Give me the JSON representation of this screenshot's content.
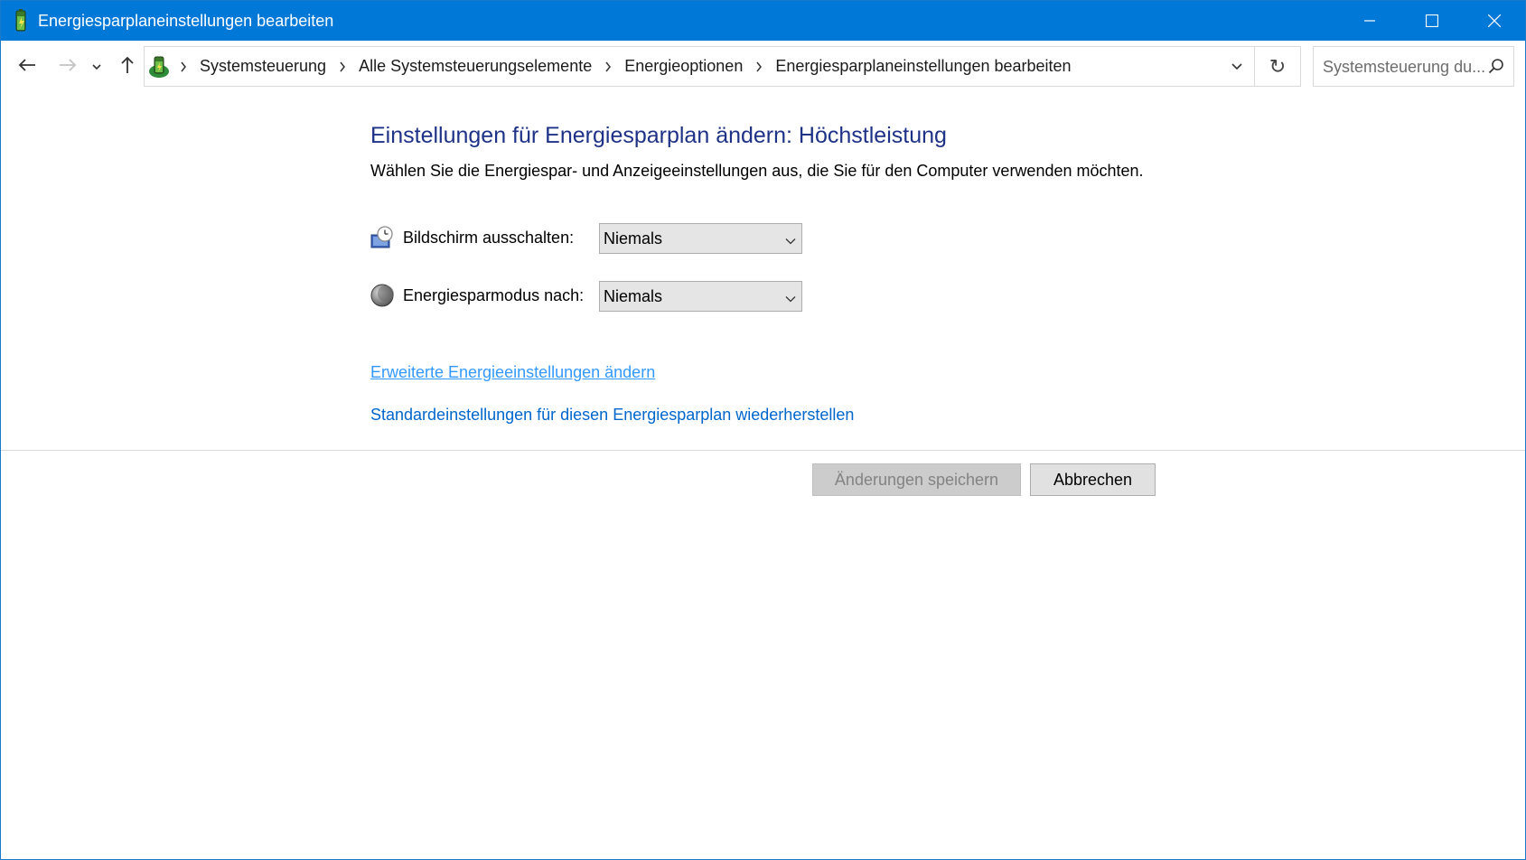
{
  "window": {
    "title": "Energiesparplaneinstellungen bearbeiten",
    "accent": "#0078d7",
    "icons": {
      "app": "power-plan-icon",
      "minimize": "minimize-icon",
      "maximize": "maximize-icon",
      "close": "close-icon"
    }
  },
  "nav": {
    "breadcrumb": [
      {
        "label": "Systemsteuerung"
      },
      {
        "label": "Alle Systemsteuerungselemente"
      },
      {
        "label": "Energieoptionen"
      },
      {
        "label": "Energiesparplaneinstellungen bearbeiten"
      }
    ],
    "search_placeholder": "Systemsteuerung du...",
    "refresh_glyph": "↻",
    "icons": {
      "back": "arrow-left-icon",
      "forward": "arrow-right-icon",
      "recent": "chevron-down-icon",
      "up": "arrow-up-icon",
      "search": "search-icon"
    }
  },
  "main": {
    "heading": "Einstellungen für Energiesparplan ändern: Höchstleistung",
    "subtext": "Wählen Sie die Energiespar- und Anzeigeeinstellungen aus, die Sie für den Computer verwenden möchten.",
    "settings": [
      {
        "label": "Bildschirm ausschalten:",
        "value": "Niemals",
        "icon": "monitor-clock-icon"
      },
      {
        "label": "Energiesparmodus nach:",
        "value": "Niemals",
        "icon": "moon-icon"
      }
    ],
    "links": {
      "advanced": "Erweiterte Energieeinstellungen ändern",
      "restore": "Standardeinstellungen für diesen Energiesparplan wiederherstellen"
    },
    "buttons": {
      "save": "Änderungen speichern",
      "save_enabled": false,
      "cancel": "Abbrechen"
    }
  }
}
